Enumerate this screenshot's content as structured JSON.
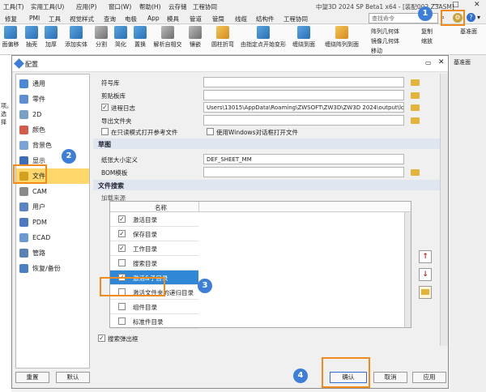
{
  "menubar": {
    "items": [
      "工具(T)",
      "实用工具(U)",
      "应用(P)",
      "窗口(W)",
      "帮助(H)",
      "云存储",
      "工程协同"
    ],
    "app_title": "中望3D 2024 SP Beta1 x64 - [装配002.Z3ASM]"
  },
  "tabs": [
    "修复",
    "PMI",
    "工具",
    "视觉样式",
    "查询",
    "电极",
    "App",
    "模具",
    "管道",
    "管筒",
    "线缆",
    "结构件",
    "工程协同"
  ],
  "search": {
    "placeholder": "查找命令"
  },
  "ribbon": {
    "buttons": [
      "面偏移",
      "抽壳",
      "加厚",
      "添加实体",
      "分割",
      "简化",
      "置换",
      "解析自相交",
      "镶嵌",
      "圆柱折弯",
      "由指定点开始变形",
      "缠绕到面",
      "缠绕阵列到面"
    ],
    "side": [
      "阵列几何体",
      "镜像几何体",
      "移动",
      "复制",
      "缩放"
    ],
    "far_right": "基准面"
  },
  "right_panel": {
    "label": "基准面"
  },
  "left_strip": {
    "lines": [
      "项。",
      "选择"
    ]
  },
  "dialog": {
    "title": "配置",
    "nav": [
      "通用",
      "零件",
      "2D",
      "颜色",
      "背景色",
      "显示",
      "文件",
      "CAM",
      "用户",
      "PDM",
      "ECAD",
      "管路",
      "恢复/备份"
    ],
    "selected_nav": "文件",
    "fields": {
      "symbol_lib": {
        "label": "符号库",
        "value": ""
      },
      "clipboard": {
        "label": "剪贴板库",
        "value": ""
      },
      "log": {
        "label": "进程日志",
        "value": "Users\\13015\\AppData\\Roaming\\ZWSOFT\\ZW3D\\ZW3D 2024\\output\\logs",
        "checked": true
      },
      "export_folder": {
        "label": "导出文件夹",
        "value": ""
      }
    },
    "readonly_ref": "在只读模式打开参考文件",
    "use_windows_dlg": "使用Windows对话框打开文件",
    "drawing_section": "草图",
    "paper_size": {
      "label": "纸张大小定义",
      "value": "DEF_SHEET_MM"
    },
    "bom_template": {
      "label": "BOM模板",
      "value": ""
    },
    "file_search_section": "文件搜索",
    "load_source": "加载来源",
    "list_header": "名称",
    "list_rows": [
      {
        "name": "激活目录",
        "checked": true
      },
      {
        "name": "保存目录",
        "checked": true
      },
      {
        "name": "工作目录",
        "checked": true
      },
      {
        "name": "搜索目录",
        "checked": false
      },
      {
        "name": "激活&子目录",
        "checked": true
      },
      {
        "name": "激活文件夹的递归目录",
        "checked": false
      },
      {
        "name": "组件目录",
        "checked": false
      },
      {
        "name": "标准件目录",
        "checked": false
      }
    ],
    "search_popup": "搜索弹出框",
    "buttons": {
      "reset": "重置",
      "default": "默认",
      "ok": "确认",
      "cancel": "取消",
      "apply": "应用"
    }
  },
  "badges": [
    "1",
    "2",
    "3",
    "4"
  ],
  "colors": {
    "selected_nav": "#ffd76a",
    "selected_row": "#2f87d6",
    "highlight": "#f08b1e",
    "badge": "#3d7fd8"
  }
}
